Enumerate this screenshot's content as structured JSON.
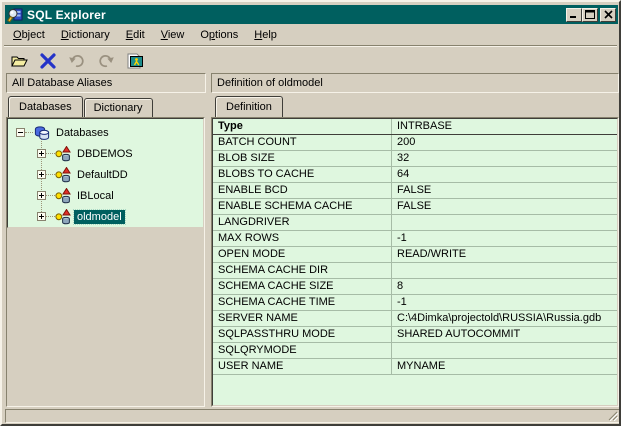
{
  "window": {
    "title": "SQL Explorer"
  },
  "menu": {
    "items": [
      {
        "label": "Object",
        "underline_index": 0
      },
      {
        "label": "Dictionary",
        "underline_index": 0
      },
      {
        "label": "Edit",
        "underline_index": 0
      },
      {
        "label": "View",
        "underline_index": 0
      },
      {
        "label": "Options",
        "underline_index": 1
      },
      {
        "label": "Help",
        "underline_index": 0
      }
    ]
  },
  "toolbar": {
    "buttons": [
      {
        "name": "open-button",
        "icon": "open-folder-icon",
        "enabled": true
      },
      {
        "name": "delete-button",
        "icon": "delete-x-icon",
        "enabled": true
      },
      {
        "name": "undo-button",
        "icon": "undo-arrow-icon",
        "enabled": false
      },
      {
        "name": "redo-button",
        "icon": "redo-arrow-icon",
        "enabled": false
      },
      {
        "name": "sql-monitor-button",
        "icon": "sql-monitor-icon",
        "enabled": true
      }
    ]
  },
  "panes": {
    "left": {
      "header": "All Database Aliases",
      "tabs": [
        {
          "label": "Databases",
          "active": true
        },
        {
          "label": "Dictionary",
          "active": false
        }
      ],
      "tree": {
        "root": {
          "label": "Databases",
          "icon": "databases-icon",
          "expanded": true
        },
        "items": [
          {
            "label": "DBDEMOS",
            "icon": "database-alias-icon",
            "expanded": false,
            "selected": false
          },
          {
            "label": "DefaultDD",
            "icon": "database-alias-icon",
            "expanded": false,
            "selected": false
          },
          {
            "label": "IBLocal",
            "icon": "database-alias-icon",
            "expanded": false,
            "selected": false
          },
          {
            "label": "oldmodel",
            "icon": "database-alias-icon",
            "expanded": false,
            "selected": true
          }
        ]
      }
    },
    "right": {
      "header": "Definition of oldmodel",
      "tabs": [
        {
          "label": "Definition",
          "active": true
        }
      ],
      "table": {
        "rows": [
          {
            "name": "Type",
            "value": "INTRBASE",
            "header": true
          },
          {
            "name": "BATCH COUNT",
            "value": "200"
          },
          {
            "name": "BLOB SIZE",
            "value": "32"
          },
          {
            "name": "BLOBS TO CACHE",
            "value": "64"
          },
          {
            "name": "ENABLE BCD",
            "value": "FALSE"
          },
          {
            "name": "ENABLE SCHEMA CACHE",
            "value": "FALSE"
          },
          {
            "name": "LANGDRIVER",
            "value": ""
          },
          {
            "name": "MAX ROWS",
            "value": "-1"
          },
          {
            "name": "OPEN MODE",
            "value": "READ/WRITE"
          },
          {
            "name": "SCHEMA CACHE DIR",
            "value": ""
          },
          {
            "name": "SCHEMA CACHE SIZE",
            "value": "8"
          },
          {
            "name": "SCHEMA CACHE TIME",
            "value": "-1"
          },
          {
            "name": "SERVER NAME",
            "value": "C:\\4Dimka\\projectold\\RUSSIA\\Russia.gdb"
          },
          {
            "name": "SQLPASSTHRU MODE",
            "value": "SHARED AUTOCOMMIT"
          },
          {
            "name": "SQLQRYMODE",
            "value": ""
          },
          {
            "name": "USER NAME",
            "value": "MYNAME"
          }
        ]
      }
    }
  },
  "colors": {
    "title_bar": "#005F5F",
    "window_face": "#D6CFC0",
    "panel_green": "#DFF7DF",
    "grid_line": "#A6BCA6",
    "sel_bg": "#005F5F",
    "sel_fg": "#FFFFFF",
    "delete_x_blue": "#2433C8"
  }
}
